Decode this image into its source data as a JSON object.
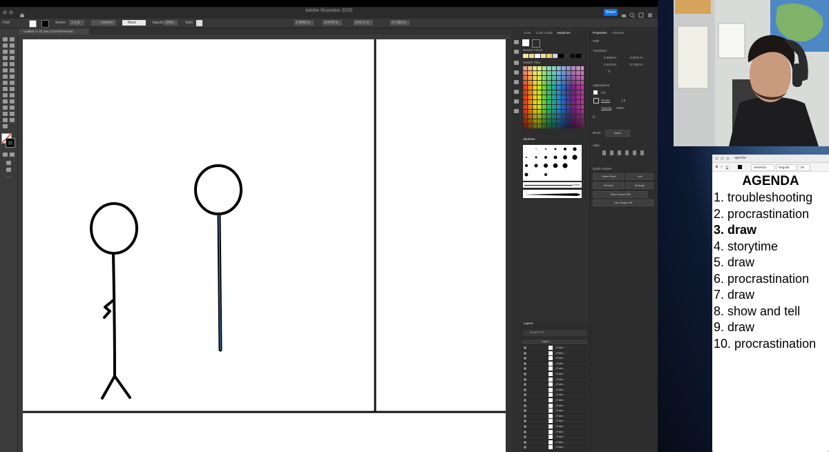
{
  "app": {
    "window_title": "Adobe Illustrator 2026",
    "share_label": "Share",
    "doc_tab": "Untitled-1* @ 33% (CMYK/Preview)"
  },
  "control_bar": {
    "selection_type": "Path",
    "stroke_label": "Stroke:",
    "stroke_value": "1.5 pt",
    "stroke_profile": "Uniform",
    "brush": "Basic",
    "opacity_label": "Opacity:",
    "opacity_value": "100%",
    "style_label": "Style:",
    "x_value": "2.3848 in",
    "y_value": "3.4478 in",
    "w_value": "0.0071 in",
    "h_value": "0.7183 in"
  },
  "swatches_panel": {
    "tabs": [
      "Color",
      "Color Guide",
      "Swatches"
    ],
    "active_tab": "Swatches",
    "recent_label": "Recent Colors",
    "group_label": "Swatch Tiles"
  },
  "brushes_panel": {
    "title": "Brushes",
    "basic_label": "Basic"
  },
  "layers_panel": {
    "title": "Layers",
    "search_placeholder": "Search All",
    "top_layer": "Layer 1",
    "rows": [
      "<Path>",
      "<Path>",
      "<Path>",
      "<Path>",
      "<Path>",
      "<Path>",
      "<Path>",
      "<Path>",
      "<Path>",
      "<Path>",
      "<Path>",
      "<Path>",
      "<Path>",
      "<Path>",
      "<Path>",
      "<Path>",
      "<Path>",
      "<Path>",
      "<Path>",
      "<Path>"
    ]
  },
  "properties_panel": {
    "tabs": [
      "Properties",
      "Libraries"
    ],
    "active_tab": "Properties",
    "selection": "Path",
    "transform_title": "Transform",
    "x": "2.3848 in",
    "y": "3.4478 in",
    "w": "0.0071 in",
    "h": "0.7183 in",
    "angle": "0°",
    "appearance_title": "Appearance",
    "fill_label": "Fill",
    "stroke_label": "Stroke",
    "stroke_value": "1.5",
    "opacity_label": "Opacity",
    "opacity_value": "100%",
    "fx_label": "fx",
    "brush_label": "Brush",
    "brush_value": "Basic",
    "align_title": "Align",
    "quick_actions_title": "Quick Actions",
    "buttons": [
      "Offset Path",
      "Join",
      "Recolor",
      "Arrange",
      "Start Global Edit",
      "Gen Shape Fill"
    ]
  },
  "agenda_app": {
    "window_title": "agenda",
    "font_name": "Helvetica",
    "font_style": "Regular",
    "font_size": "50",
    "heading": "AGENDA",
    "items": [
      "1. troubleshooting",
      "2. procrastination",
      "3. draw",
      "4. storytime",
      "5. draw",
      "6. procrastination",
      "7. draw",
      "8. show and tell",
      "9. draw",
      "10. procrastination"
    ],
    "bold_item_index": 2
  },
  "colors": {
    "accent_blue": "#1473e6",
    "panel_bg": "#2d2d2d",
    "canvas_bg": "#ffffff",
    "selection_blue": "#4a90d9"
  }
}
